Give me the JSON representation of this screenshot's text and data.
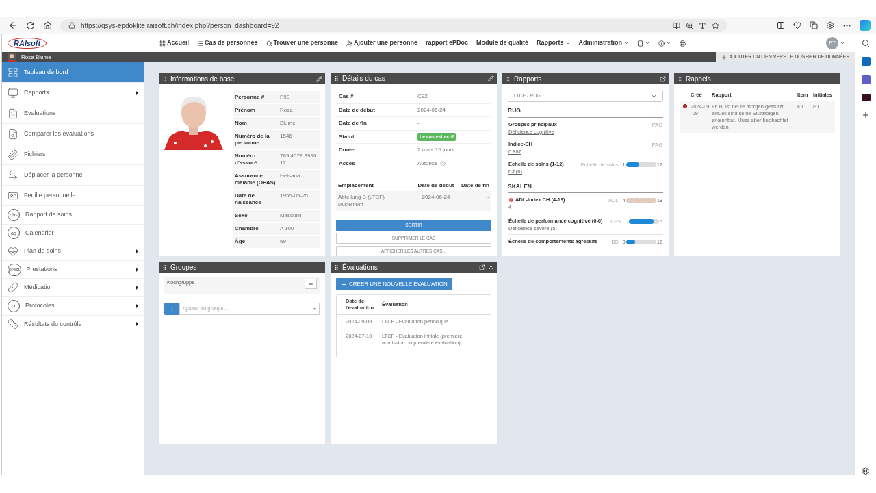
{
  "browser": {
    "url": "https://qsys-epdoklite.raisoft.ch/index.php?person_dashboard=92"
  },
  "nav": {
    "logo": "RAIsoft",
    "items": [
      {
        "label": "Accueil",
        "dropdown": false
      },
      {
        "label": "Cas de personnes",
        "dropdown": false
      },
      {
        "label": "Trouver une personne",
        "dropdown": false
      },
      {
        "label": "Ajouter une personne",
        "dropdown": false
      },
      {
        "label": "rapport ePDoc",
        "dropdown": false
      },
      {
        "label": "Module de qualité",
        "dropdown": false
      },
      {
        "label": "Rapports",
        "dropdown": true
      },
      {
        "label": "Administration",
        "dropdown": true
      }
    ],
    "tools": [
      {
        "dropdown": true
      },
      {
        "dropdown": true
      },
      {
        "dropdown": false
      }
    ],
    "avatar_initials": "PT"
  },
  "person_bar": {
    "name": "Rosa Blume",
    "link_button": "AJOUTER UN LIEN VERS LE DOSSIER DE DONNÉES"
  },
  "sidebar": {
    "items": [
      {
        "label": "Tableau de bord",
        "selected": true,
        "submenu": false
      },
      {
        "label": "Rapports",
        "selected": false,
        "submenu": true
      },
      {
        "label": "Évaluations",
        "selected": false,
        "submenu": false
      },
      {
        "label": "Comparer les évaluations",
        "selected": false,
        "submenu": false
      },
      {
        "label": "Fichiers",
        "selected": false,
        "submenu": false
      },
      {
        "label": "Déplacer la personne",
        "selected": false,
        "submenu": false
      },
      {
        "label": "Feuille personnelle",
        "selected": false,
        "submenu": false
      },
      {
        "label": "Rapport de soins",
        "selected": false,
        "submenu": false,
        "icon_text": "obs"
      },
      {
        "label": "Calendrier",
        "selected": false,
        "submenu": false,
        "icon_text": "ag"
      },
      {
        "label": "Plan de soins",
        "selected": false,
        "submenu": true
      },
      {
        "label": "Prestations",
        "selected": false,
        "submenu": true,
        "icon_text": "prest"
      },
      {
        "label": "Médication",
        "selected": false,
        "submenu": true
      },
      {
        "label": "Protocoles",
        "selected": false,
        "submenu": true,
        "icon_text": "pr"
      },
      {
        "label": "Résultats du contrôle",
        "selected": false,
        "submenu": true
      }
    ]
  },
  "base_info": {
    "title": "Informations de base",
    "rows": [
      {
        "label": "Personne #",
        "value": "P90"
      },
      {
        "label": "Prénom",
        "value": "Rosa"
      },
      {
        "label": "Nom",
        "value": "Blume"
      },
      {
        "label": "Numéro de la personne",
        "value": "1546"
      },
      {
        "label": "Numéro d'assuré",
        "value": "789.4578.8996.12"
      },
      {
        "label": "Assurance maladie (OPAS)",
        "value": "Helsana"
      },
      {
        "label": "Date de naissance",
        "value": "1955-05-25"
      },
      {
        "label": "Sexe",
        "value": "Masculin"
      },
      {
        "label": "Chambre",
        "value": "A 100"
      },
      {
        "label": "Âge",
        "value": "69"
      }
    ]
  },
  "case": {
    "title": "Détails du cas",
    "rows": [
      {
        "label": "Cas #",
        "value": "C92",
        "kind": "text"
      },
      {
        "label": "Date de début",
        "value": "2024-06-24",
        "kind": "text"
      },
      {
        "label": "Date de fin",
        "value": "-",
        "kind": "text"
      },
      {
        "label": "Statut",
        "value": "Le cas est actif",
        "kind": "badge"
      },
      {
        "label": "Durée",
        "value": "2 mois 16 jours",
        "kind": "text"
      },
      {
        "label": "Accès",
        "value": "Autorisé",
        "kind": "help"
      }
    ],
    "location_columns": [
      "Emplacement",
      "Date de début",
      "Date de fin"
    ],
    "locations": [
      {
        "name": "Abteilung B (LTCF)",
        "sub": "Musterheim",
        "start": "2024-06-24",
        "end": "-"
      }
    ],
    "buttons": [
      {
        "label": "SORTIR",
        "kind": "primary"
      },
      {
        "label": "SUPPRIMER LE CAS",
        "kind": "default"
      },
      {
        "label": "AFFICHER LES AUTRES CAS...",
        "kind": "default"
      }
    ]
  },
  "reports": {
    "title": "Rapports",
    "select": "LTCF - RUG",
    "sections": [
      {
        "heading": "RUG",
        "items": [
          {
            "name": "Groupes principaux",
            "value": "Déficience cognitive",
            "code": "PAG",
            "kind": "plain",
            "alert": false
          },
          {
            "name": "Indice-CH",
            "value": "0.887",
            "code": "PAG",
            "kind": "plain",
            "alert": false
          },
          {
            "name": "Echelle de soins (1-12)",
            "value": "6-f (6)",
            "code": "Echelle de soins",
            "kind": "bar",
            "min": "1",
            "max": "12",
            "level": 0.45,
            "alert": false
          }
        ]
      },
      {
        "heading": "SKALEN",
        "items": [
          {
            "name": "ADL-Index CH (4-18)",
            "value": "4",
            "code": "ADL",
            "kind": "hatched",
            "min": "4",
            "max": "18",
            "level": 0,
            "alert": true
          },
          {
            "name": "Échelle de performance cognitive (0-6)",
            "value": "Déficience sévère (5)",
            "code": "CPS",
            "kind": "bar",
            "min": "0",
            "max": "6",
            "level": 0.83,
            "alert": false
          },
          {
            "name": "Échelle de comportements agressifs",
            "code": "BS",
            "kind": "bar",
            "min": "0",
            "max": "12",
            "level": 0.3,
            "alert": false
          }
        ]
      }
    ]
  },
  "reminders": {
    "title": "Rappels",
    "columns": [
      "Créé",
      "Rapport",
      "Item",
      "Initiales"
    ],
    "rows": [
      {
        "alert": true,
        "created": "2024-09-09",
        "report": "Fr. B. ist heute morgen gestürzt. aktuell sind keine Sturzfolgen erkennbar. Muss aber beobachtet werden",
        "item": "K1",
        "initials": "PT"
      }
    ]
  },
  "groups": {
    "title": "Groupes",
    "items": [
      "Kochgruppe"
    ],
    "add_placeholder": "Ajouter au groupe..."
  },
  "evaluations": {
    "title": "Évaluations",
    "create_button": "CRÉER UNE NOUVELLE ÉVALUATION",
    "columns": [
      "Date de l'évaluation",
      "Évaluation"
    ],
    "rows": [
      {
        "date": "2024-09-09",
        "name": "LTCF - Evaluation périodique"
      },
      {
        "date": "2024-07-10",
        "name": "LTCF - Evaluation initiale (première admission ou première évaluation)"
      }
    ]
  }
}
